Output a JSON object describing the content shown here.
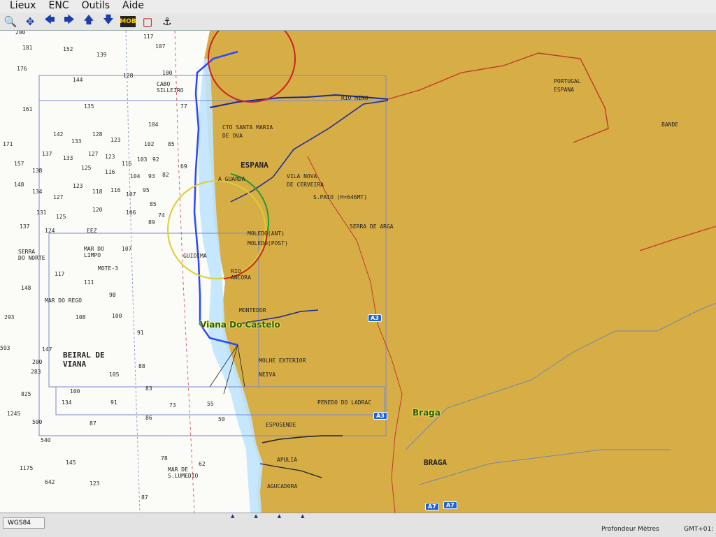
{
  "menu": [
    "Lieux",
    "ENC",
    "Outils",
    "Aide"
  ],
  "toolbar_icons": [
    "magnifier-icon",
    "move-icon",
    "arrow-left-icon",
    "arrow-right-icon",
    "arrow-up-icon",
    "arrow-down-icon",
    "mob-icon",
    "square-icon",
    "anchor-icon"
  ],
  "toolbar_badge": "MOB",
  "colors": {
    "sea": "#ffffff",
    "shallow": "#bfe4ff",
    "land": "#d9b04a",
    "route": "#2a48ff",
    "border": "#cc3322"
  },
  "sea_labels": [
    {
      "t": "200"
    },
    {
      "t": "181"
    },
    {
      "t": "152"
    },
    {
      "t": "139"
    },
    {
      "t": "117"
    },
    {
      "t": "107"
    },
    {
      "t": "176"
    },
    {
      "t": "128"
    },
    {
      "t": "100"
    },
    {
      "t": "144"
    },
    {
      "t": "135"
    },
    {
      "t": "161"
    },
    {
      "t": "77"
    },
    {
      "t": "104"
    },
    {
      "t": "142"
    },
    {
      "t": "133"
    },
    {
      "t": "128"
    },
    {
      "t": "123"
    },
    {
      "t": "171"
    },
    {
      "t": "102"
    },
    {
      "t": "85"
    },
    {
      "t": "137"
    },
    {
      "t": "133"
    },
    {
      "t": "127"
    },
    {
      "t": "123"
    },
    {
      "t": "116"
    },
    {
      "t": "103"
    },
    {
      "t": "92"
    },
    {
      "t": "157"
    },
    {
      "t": "138"
    },
    {
      "t": "125"
    },
    {
      "t": "116"
    },
    {
      "t": "104"
    },
    {
      "t": "93"
    },
    {
      "t": "82"
    },
    {
      "t": "69"
    },
    {
      "t": "148"
    },
    {
      "t": "134"
    },
    {
      "t": "127"
    },
    {
      "t": "123"
    },
    {
      "t": "118"
    },
    {
      "t": "116"
    },
    {
      "t": "107"
    },
    {
      "t": "95"
    },
    {
      "t": "131"
    },
    {
      "t": "125"
    },
    {
      "t": "120"
    },
    {
      "t": "106"
    },
    {
      "t": "85"
    },
    {
      "t": "74"
    },
    {
      "t": "137"
    },
    {
      "t": "124"
    },
    {
      "t": "89"
    },
    {
      "t": "107"
    },
    {
      "t": "117"
    },
    {
      "t": "111"
    },
    {
      "t": "148"
    },
    {
      "t": "98"
    },
    {
      "t": "293"
    },
    {
      "t": "108"
    },
    {
      "t": "100"
    },
    {
      "t": "91"
    },
    {
      "t": "593"
    },
    {
      "t": "147"
    },
    {
      "t": "200"
    },
    {
      "t": "283"
    },
    {
      "t": "105"
    },
    {
      "t": "88"
    },
    {
      "t": "825"
    },
    {
      "t": "100"
    },
    {
      "t": "134"
    },
    {
      "t": "91"
    },
    {
      "t": "83"
    },
    {
      "t": "73"
    },
    {
      "t": "1245"
    },
    {
      "t": "500"
    },
    {
      "t": "87"
    },
    {
      "t": "86"
    },
    {
      "t": "540"
    },
    {
      "t": "145"
    },
    {
      "t": "1175"
    },
    {
      "t": "642"
    },
    {
      "t": "123"
    },
    {
      "t": "78"
    },
    {
      "t": "87"
    },
    {
      "t": "55"
    },
    {
      "t": "50"
    },
    {
      "t": "62"
    }
  ],
  "labels": {
    "cabo": "CABO\nSILLEIRO",
    "rio_minho": "RIO MINO",
    "cto": "CTO SANTA MARIA",
    "de_ova": "DE OVA",
    "portugal": "PORTUGAL",
    "espana_border": "ESPANA",
    "bande": "BANDE",
    "espana": "ESPANA",
    "vila_nova": "VILA NOVA",
    "de_cerveira": "DE CERVEIRA",
    "a_guarda": "A GUARDA",
    "s_paio": "S.PAIO (H=646MT)",
    "serra_arga": "SERRA DE ARGA",
    "eez": "EEZ",
    "serra_norte": "SERRA\nDO NORTE",
    "mar_limpo": "MAR DO\nLIMPO",
    "mote": "MOTE-3",
    "moledo_ant": "MOLEDO(ANT)",
    "moledo_post": "MOLEDO(POST)",
    "guidima": "GUIDIMA",
    "rio_ancora": "RIO\nANCORA",
    "mar_rego": "MAR DO REGO",
    "montedor": "MONTEDOR",
    "viana": "Viana Do Castelo",
    "beiral": "BEIRAL DE\nVIANA",
    "molhe": "MOLHE EXTERIOR",
    "neiva": "NEIVA",
    "penedo": "PENEDO DO LADRAC",
    "braga_city": "Braga",
    "braga": "BRAGA",
    "esposende": "ESPOSENDE",
    "apulia": "APULIA",
    "mar_lumedio": "MAR DE\nS.LUMEDIO",
    "aguacadora": "AGUCADORA"
  },
  "road_shields": [
    "A3",
    "A3",
    "A7",
    "A7"
  ],
  "status": {
    "datum": "WGS84",
    "depth": "Profondeur Mètres",
    "gmt": "GMT+01:"
  }
}
